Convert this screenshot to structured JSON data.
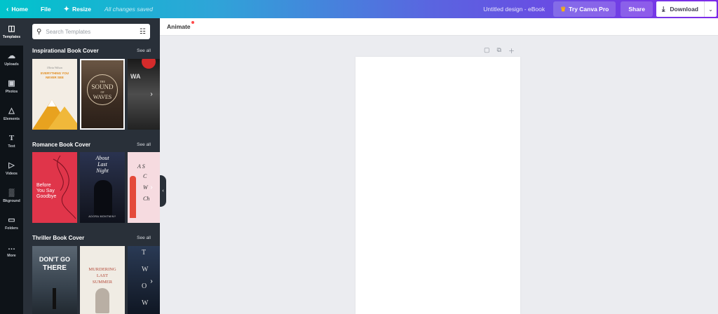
{
  "topbar": {
    "home_label": "Home",
    "file_label": "File",
    "resize_label": "Resize",
    "saved_status": "All changes saved",
    "doc_title": "Untitled design - eBook",
    "pro_label": "Try Canva Pro",
    "share_label": "Share",
    "download_label": "Download"
  },
  "rail": {
    "items": [
      {
        "label": "Templates",
        "icon": "templates-icon"
      },
      {
        "label": "Uploads",
        "icon": "upload-cloud-icon"
      },
      {
        "label": "Photos",
        "icon": "image-icon"
      },
      {
        "label": "Elements",
        "icon": "shapes-icon"
      },
      {
        "label": "Text",
        "icon": "text-icon"
      },
      {
        "label": "Videos",
        "icon": "play-icon"
      },
      {
        "label": "Bkground",
        "icon": "background-icon"
      },
      {
        "label": "Folders",
        "icon": "folder-icon"
      },
      {
        "label": "More",
        "icon": "ellipsis-icon"
      }
    ]
  },
  "panel": {
    "search_placeholder": "Search Templates",
    "see_all": "See all",
    "sections": [
      {
        "title": "Inspirational Book Cover",
        "covers": [
          {
            "lines": [
              "EVERYTHING YOU",
              "NEVER SEE"
            ],
            "author": "Olivia Wilson",
            "bg": "#f3ede4",
            "accent": "#e8a21f"
          },
          {
            "lines": [
              "THE",
              "SOUND",
              "OF",
              "WAVES"
            ],
            "bg": "#4d3a2c",
            "accent": "#d8c6aa"
          },
          {
            "lines": [
              "WA"
            ],
            "bg": "#2d2d2d",
            "accent": "#d52b2b"
          }
        ]
      },
      {
        "title": "Romance Book Cover",
        "covers": [
          {
            "lines": [
              "Before",
              "You Say",
              "Goodbye"
            ],
            "bg": "#e0354a",
            "accent": "#ffffff"
          },
          {
            "lines": [
              "About",
              "Last",
              "Night"
            ],
            "author": "ADORA MONTMINY",
            "bg": "#1b1f2e",
            "accent": "#ffffff"
          },
          {
            "lines": [
              "A S",
              "C",
              "W",
              "Ch"
            ],
            "bg": "#f6dbe0",
            "accent": "#e44a3a"
          }
        ]
      },
      {
        "title": "Thriller Book Cover",
        "covers": [
          {
            "lines": [
              "DON'T GO",
              "THERE"
            ],
            "bg": "#3a4652",
            "accent": "#ffffff"
          },
          {
            "lines": [
              "MURDERING",
              "LAST",
              "SUMMER"
            ],
            "bg": "#f0ece4",
            "accent": "#b34a3a"
          },
          {
            "lines": [
              "T",
              "W",
              "O",
              "W"
            ],
            "bg": "#1a2435",
            "accent": "#ffffff"
          }
        ]
      }
    ]
  },
  "secbar": {
    "animate_label": "Animate"
  },
  "colors": {
    "panel_bg": "#293039",
    "rail_bg": "#0e1318",
    "brand_purple": "#7d2ae8",
    "brand_teal": "#00c4cc"
  }
}
